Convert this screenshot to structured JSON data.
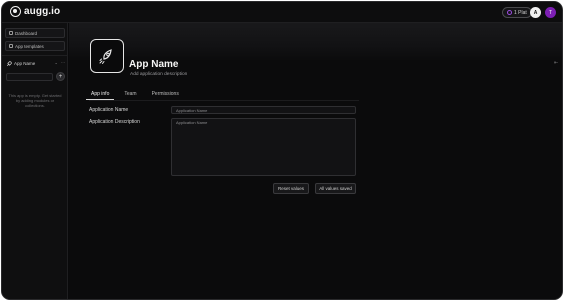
{
  "brand": {
    "name": "augg.io"
  },
  "header": {
    "credits": "1 Plat",
    "avatar_initial_1": "A",
    "avatar_initial_2": "T"
  },
  "sidebar": {
    "nav": [
      {
        "label": "Dashboard",
        "icon": "home-icon"
      },
      {
        "label": "App templates",
        "icon": "template-icon"
      }
    ],
    "apps_title": "App Name",
    "actions": "⌄ ⋯",
    "add": "+",
    "empty_text": "This app is empty. Get started by adding modules or collections."
  },
  "app": {
    "name": "App Name",
    "description": "Add application description"
  },
  "tabs": [
    "App info",
    "Team",
    "Permissions"
  ],
  "form": {
    "name_label": "Application Name",
    "name_placeholder": "Application Name",
    "description_label": "Application Description",
    "description_placeholder": "Application Name"
  },
  "buttons": {
    "reset": "Reset values",
    "saved": "All values saved"
  }
}
